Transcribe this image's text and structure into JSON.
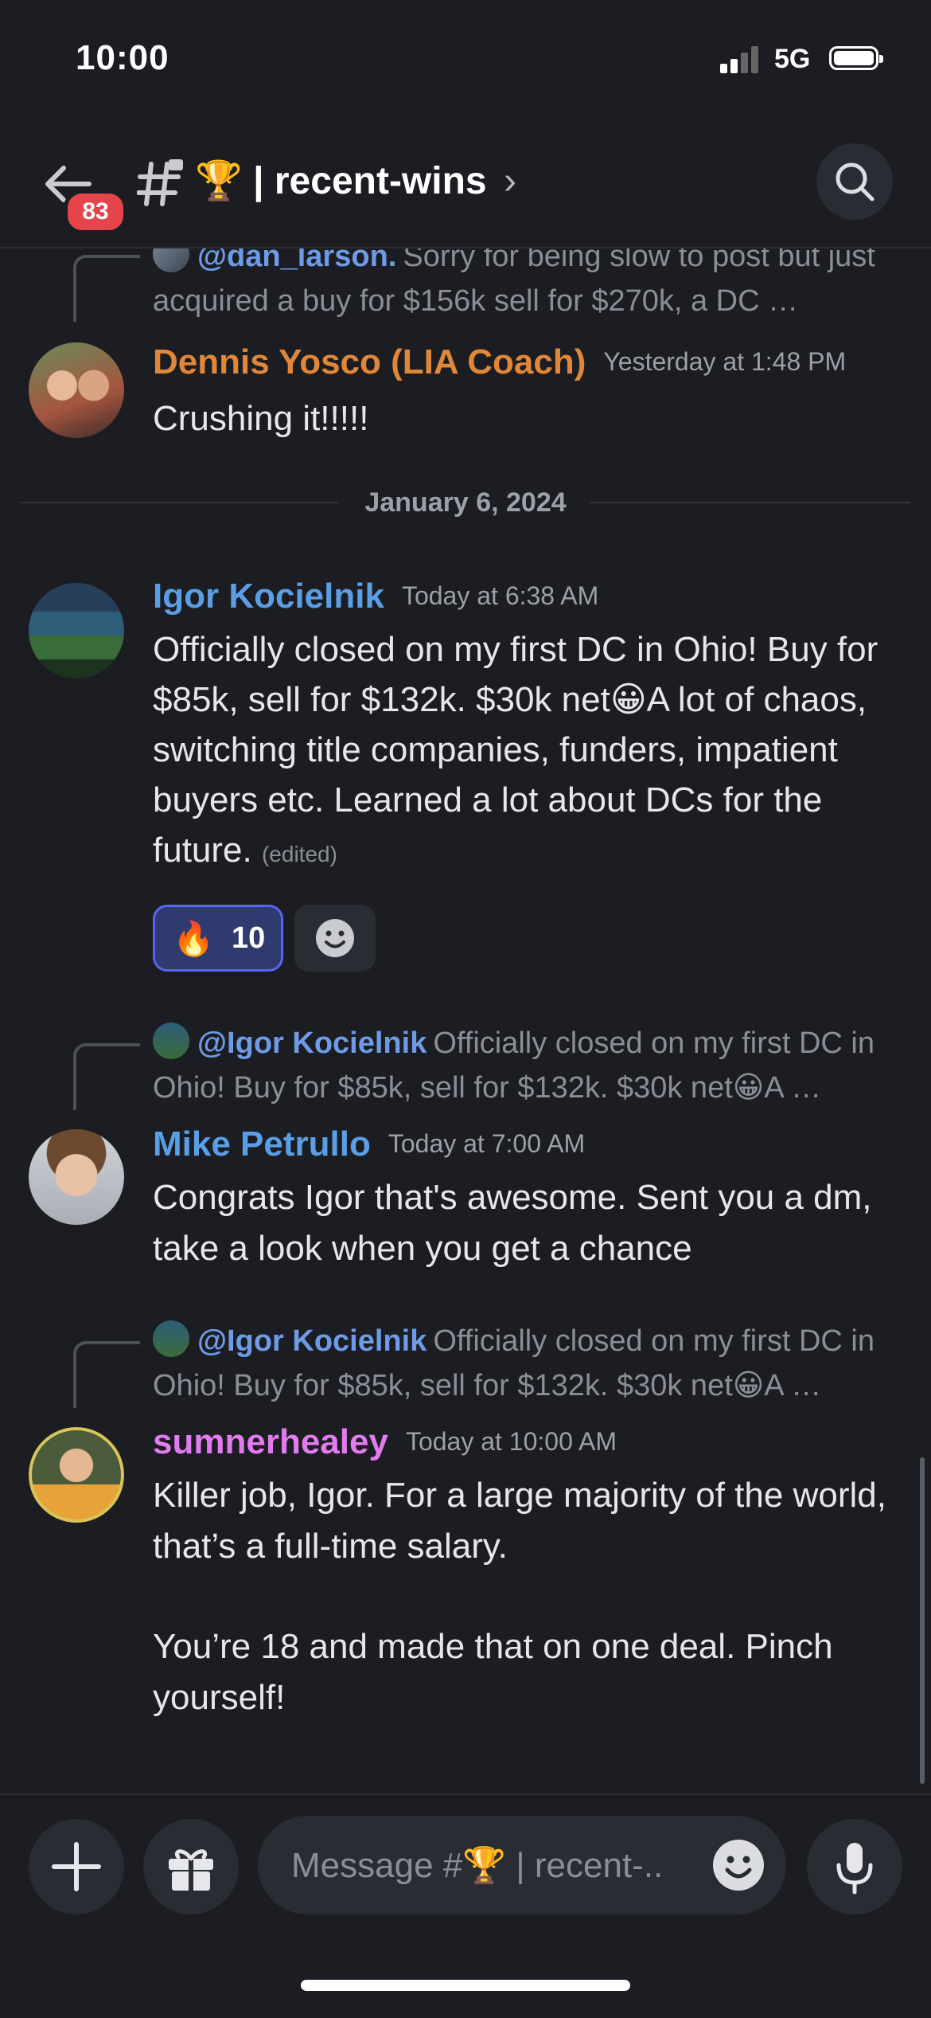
{
  "status_bar": {
    "time": "10:00",
    "network": "5G"
  },
  "header": {
    "unread_badge": "83",
    "channel_emoji": "🏆",
    "channel_name": "| recent-wins",
    "chevron": "›"
  },
  "messages": [
    {
      "reply_to": {
        "mention": "@dan_larson.",
        "preview": "Sorry for being slow to post but just acquired a buy for $156k sell for $270k, a DC …"
      },
      "author": "Dennis Yosco (LIA Coach)",
      "author_color": "#e0873a",
      "timestamp": "Yesterday at 1:48 PM",
      "text": "Crushing it!!!!!"
    },
    {
      "author": "Igor Kocielnik",
      "author_color": "#5a9fe6",
      "timestamp": "Today at 6:38 AM",
      "text": "Officially closed on my first DC in Ohio! Buy for $85k, sell for $132k. $30k net😀A lot of chaos, switching title companies, funders, impatient buyers etc. Learned a lot about DCs for the future.",
      "edited_label": "(edited)",
      "reaction": {
        "emoji": "🔥",
        "count": "10"
      }
    },
    {
      "reply_to": {
        "mention": "@Igor Kocielnik",
        "preview": "Officially closed on my first DC in Ohio! Buy for $85k, sell for $132k. $30k net😀A …"
      },
      "author": "Mike Petrullo",
      "author_color": "#5a9fe6",
      "timestamp": "Today at 7:00 AM",
      "text": "Congrats Igor that's awesome. Sent you a dm, take a look when you get a chance"
    },
    {
      "reply_to": {
        "mention": "@Igor Kocielnik",
        "preview": "Officially closed on my first DC in Ohio! Buy for $85k, sell for $132k. $30k net😀A …"
      },
      "author": "sumnerhealey",
      "author_color": "#e27bef",
      "timestamp": "Today at 10:00 AM",
      "text": "Killer job, Igor. For a large majority of the world, that’s a full-time salary.",
      "text2": "You’re 18 and made that on one deal. Pinch yourself!"
    }
  ],
  "date_divider": "January 6, 2024",
  "composer": {
    "placeholder": "Message #🏆 | recent-.."
  },
  "icons": {
    "back": "arrow-left-icon",
    "channel": "hash-icon",
    "search": "search-icon",
    "add": "plus-icon",
    "gift": "gift-icon",
    "emoji": "smiley-icon",
    "mic": "microphone-icon"
  }
}
